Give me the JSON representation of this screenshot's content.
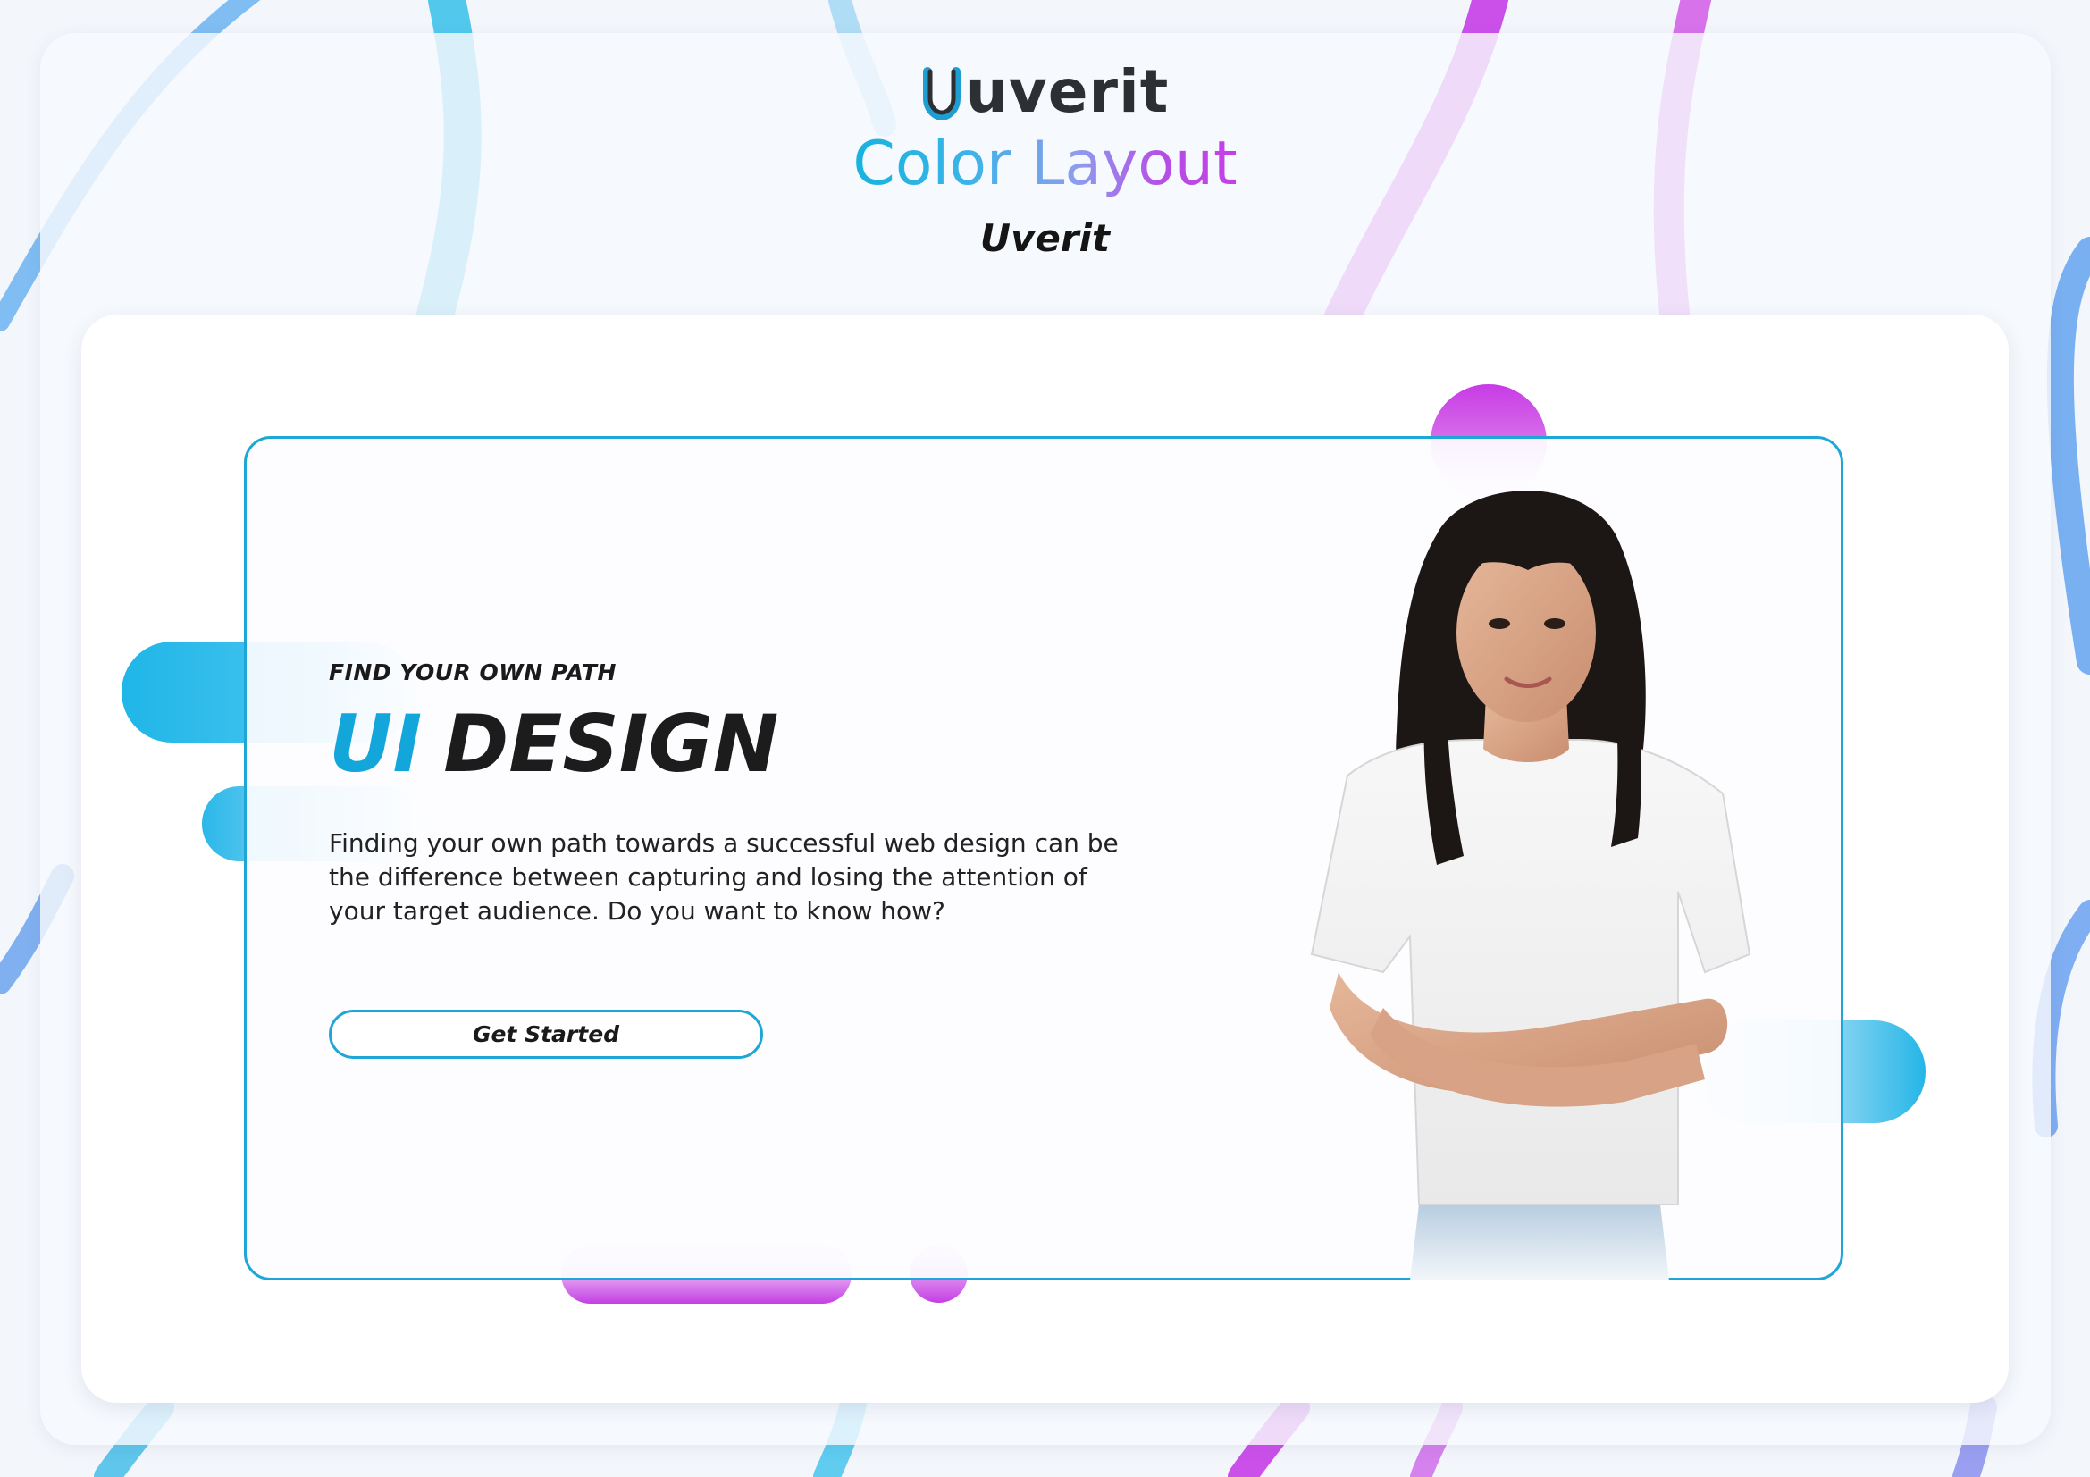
{
  "header": {
    "brand": "uverit",
    "title": "Color Layout",
    "subtitle": "Uverit"
  },
  "hero": {
    "eyebrow": "FIND YOUR OWN PATH",
    "headline_accent": "UI",
    "headline_rest": "DESIGN",
    "body": "Finding your own path towards a successful web design can be the difference between capturing and losing the attention of your target audience. Do you want to know how?",
    "cta_label": "Get Started",
    "image_alt": "woman-with-crossed-arms-photo"
  },
  "colors": {
    "accent_blue": "#13a6db",
    "accent_purple": "#c63ee8",
    "frame_border": "#1ea7d6",
    "text_dark": "#1c1c1c"
  },
  "icons": {
    "logo_mark": "u-letter-logo-icon"
  }
}
